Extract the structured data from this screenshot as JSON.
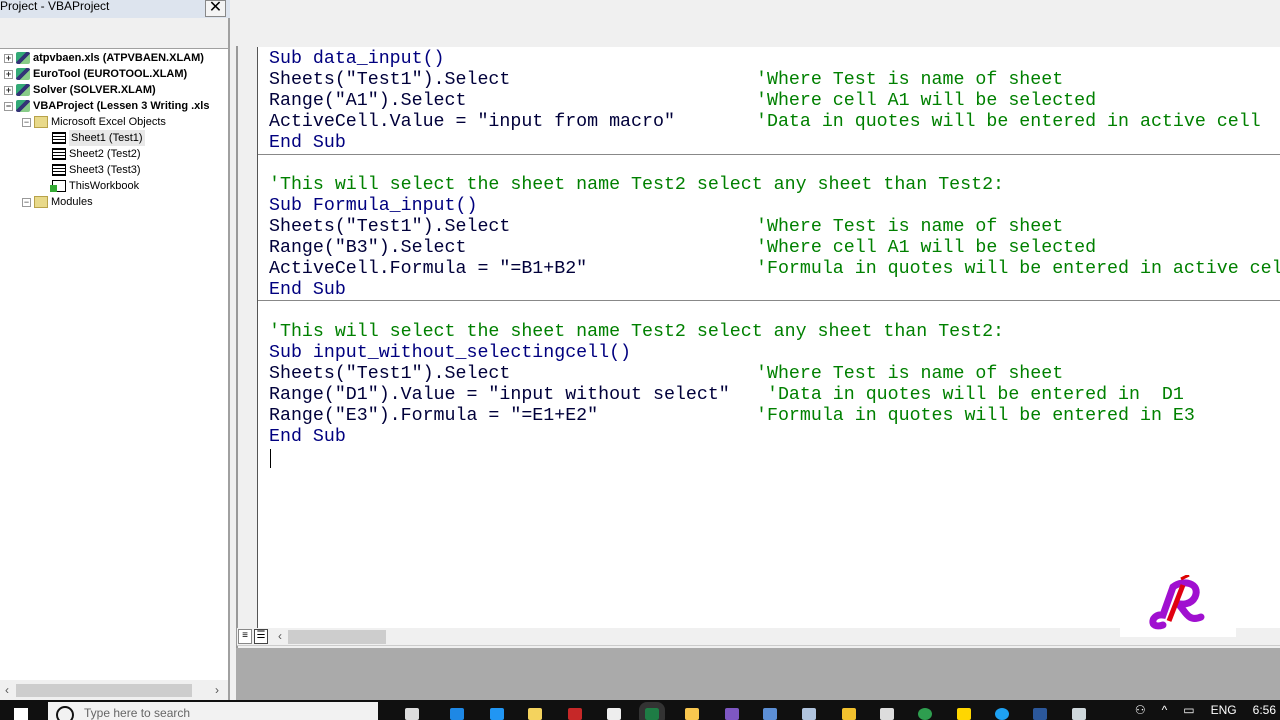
{
  "explorer": {
    "title": "Project - VBAProject",
    "close": "✕",
    "nodes": [
      {
        "label": "atpvbaen.xls (ATPVBAEN.XLAM)",
        "expander": "+"
      },
      {
        "label": "EuroTool (EUROTOOL.XLAM)",
        "expander": "+"
      },
      {
        "label": "Solver (SOLVER.XLAM)",
        "expander": "+"
      },
      {
        "label": "VBAProject (Lessen 3 Writing .xls",
        "expander": "−"
      },
      {
        "label": "Microsoft Excel Objects",
        "expander": "−"
      },
      {
        "label": "Sheet1 (Test1)"
      },
      {
        "label": "Sheet2 (Test2)"
      },
      {
        "label": "Sheet3 (Test3)"
      },
      {
        "label": "ThisWorkbook"
      },
      {
        "label": "Modules",
        "expander": "−"
      }
    ]
  },
  "code": {
    "lines": [
      {
        "code": "Sub data_input()",
        "kw": true,
        "comment": ""
      },
      {
        "code": "Sheets(\"Test1\").Select",
        "comment": "'Where Test is name of sheet"
      },
      {
        "code": "Range(\"A1\").Select",
        "comment": "'Where cell A1 will be selected"
      },
      {
        "code": "ActiveCell.Value = \"input from macro\"",
        "comment": "'Data in quotes will be entered in active cell"
      },
      {
        "code": "End Sub",
        "kw": true,
        "comment": ""
      },
      {
        "code": "",
        "comment": "'This will select the sheet name Test2 select any sheet than Test2:",
        "full": true
      },
      {
        "code": "Sub Formula_input()",
        "kw": true,
        "comment": ""
      },
      {
        "code": "Sheets(\"Test1\").Select",
        "comment": "'Where Test is name of sheet"
      },
      {
        "code": "Range(\"B3\").Select",
        "comment": "'Where cell A1 will be selected"
      },
      {
        "code": "ActiveCell.Formula = \"=B1+B2\"",
        "comment": "'Formula in quotes will be entered in active cell"
      },
      {
        "code": "End Sub",
        "kw": true,
        "comment": ""
      },
      {
        "code": "",
        "comment": "'This will select the sheet name Test2 select any sheet than Test2:",
        "full": true
      },
      {
        "code": "Sub input_without_selectingcell()",
        "kw": true,
        "comment": ""
      },
      {
        "code": "Sheets(\"Test1\").Select",
        "comment": "'Where Test is name of sheet"
      },
      {
        "code": "Range(\"D1\").Value = \"input without select\"",
        "comment": " 'Data in quotes will be entered in  D1"
      },
      {
        "code": "Range(\"E3\").Formula = \"=E1+E2\"",
        "comment": "'Formula in quotes will be entered in E3"
      },
      {
        "code": "End Sub",
        "kw": true,
        "comment": ""
      }
    ]
  },
  "taskbar": {
    "search_placeholder": "Type here to search",
    "language": "ENG",
    "time": "6:56"
  },
  "logo_text": "R",
  "colors": {
    "keyword": "#00007f",
    "comment": "#008000",
    "mdi_background": "#aaaaaa"
  }
}
